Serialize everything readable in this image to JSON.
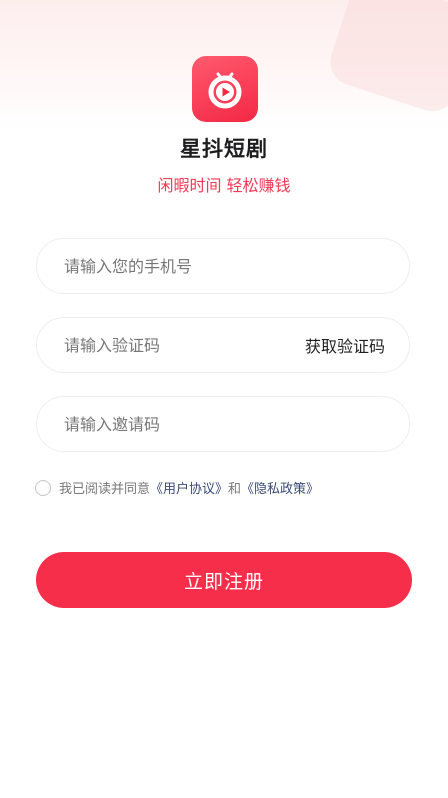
{
  "app": {
    "name": "星抖短剧",
    "slogan": "闲暇时间 轻松赚钱",
    "logo_icon": "play-icon",
    "accent_color": "#f72e4a"
  },
  "form": {
    "phone_placeholder": "请输入您的手机号",
    "phone_value": "",
    "code_placeholder": "请输入验证码",
    "code_value": "",
    "get_code_label": "获取验证码",
    "invite_placeholder": "请输入邀请码",
    "invite_value": ""
  },
  "agreement": {
    "checked": false,
    "prefix": "我已阅读并同意",
    "user_agreement": "《用户协议》",
    "connector": "和",
    "privacy_policy": "《隐私政策》"
  },
  "register_button": "立即注册"
}
